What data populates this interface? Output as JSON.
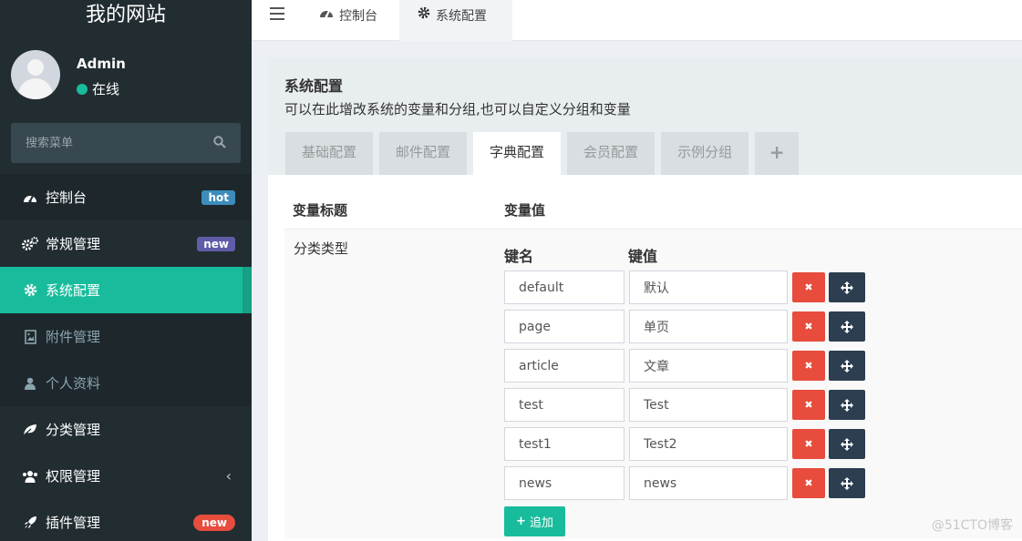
{
  "app": {
    "title": "我的网站"
  },
  "user": {
    "name": "Admin",
    "status": "在线"
  },
  "search": {
    "placeholder": "搜索菜单"
  },
  "sidebar": {
    "items": [
      {
        "label": "控制台",
        "badge": "hot"
      },
      {
        "label": "常规管理",
        "badge": "new"
      },
      {
        "label": "系统配置"
      },
      {
        "label": "附件管理"
      },
      {
        "label": "个人资料"
      },
      {
        "label": "分类管理"
      },
      {
        "label": "权限管理",
        "chevron": "‹"
      },
      {
        "label": "插件管理",
        "badge": "new"
      }
    ]
  },
  "topnav": {
    "tabs": [
      {
        "label": "控制台"
      },
      {
        "label": "系统配置"
      }
    ]
  },
  "panel": {
    "title": "系统配置",
    "subtitle": "可以在此增改系统的变量和分组,也可以自定义分组和变量",
    "tabs": [
      "基础配置",
      "邮件配置",
      "字典配置",
      "会员配置",
      "示例分组"
    ],
    "add_tab": "+"
  },
  "table": {
    "header_title": "变量标题",
    "header_value": "变量值",
    "row_label": "分类类型",
    "key_header": "键名",
    "value_header": "键值",
    "entries": [
      {
        "key": "default",
        "value": "默认"
      },
      {
        "key": "page",
        "value": "单页"
      },
      {
        "key": "article",
        "value": "文章"
      },
      {
        "key": "test",
        "value": "Test"
      },
      {
        "key": "test1",
        "value": "Test2"
      },
      {
        "key": "news",
        "value": "news"
      }
    ],
    "delete_icon": "✖",
    "add_button": "追加"
  },
  "watermark": "@51CTO博客",
  "colors": {
    "accent": "#18bc9c",
    "sidebar": "#222d32",
    "danger": "#e74c3c",
    "dark": "#2c3e50"
  }
}
